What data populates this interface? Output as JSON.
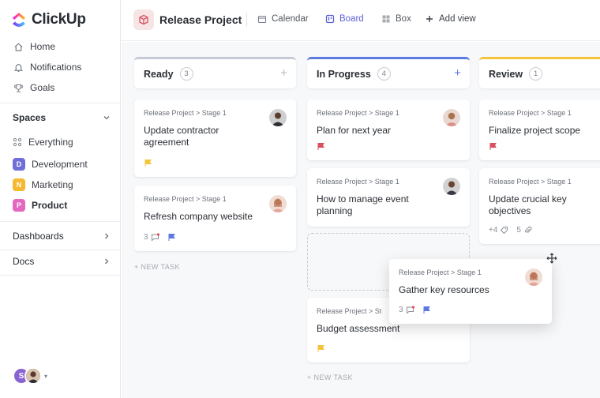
{
  "app": {
    "name": "ClickUp"
  },
  "sidebar": {
    "nav": [
      {
        "label": "Home",
        "icon": "home-icon"
      },
      {
        "label": "Notifications",
        "icon": "bell-icon"
      },
      {
        "label": "Goals",
        "icon": "trophy-icon"
      }
    ],
    "spaces_label": "Spaces",
    "spaces": [
      {
        "label": "Everything",
        "badge": ""
      },
      {
        "label": "Development",
        "badge": "D",
        "color": "#6f6fd8"
      },
      {
        "label": "Marketing",
        "badge": "N",
        "color": "#f5b82e"
      },
      {
        "label": "Product",
        "badge": "P",
        "color": "#e468c0"
      }
    ],
    "dashboards_label": "Dashboards",
    "docs_label": "Docs",
    "user_initial": "S"
  },
  "header": {
    "project_title": "Release Project",
    "views": [
      {
        "label": "Calendar"
      },
      {
        "label": "Board"
      },
      {
        "label": "Box"
      },
      {
        "label": "Add view"
      }
    ]
  },
  "board": {
    "new_task_label": "+ NEW TASK",
    "columns": [
      {
        "name": "Ready",
        "count": "3",
        "accent": "#c7c9d6",
        "cards": [
          {
            "crumb": "Release Project > Stage 1",
            "title": "Update contractor agreement",
            "flag": "#f5c43c"
          },
          {
            "crumb": "Release Project > Stage 1",
            "title": "Refresh company website",
            "comments": "3",
            "flag": "#5b7ae0"
          }
        ]
      },
      {
        "name": "In Progress",
        "count": "4",
        "accent": "#5b7ae0",
        "cards": [
          {
            "crumb": "Release Project > Stage 1",
            "title": "Plan for next year",
            "flag": "#d9505e"
          },
          {
            "crumb": "Release Project > Stage 1",
            "title": "How to manage event planning"
          },
          {
            "crumb": "Release Project > St",
            "title": "Budget assessment",
            "flag": "#f5c43c"
          }
        ]
      },
      {
        "name": "Review",
        "count": "1",
        "accent": "#f5c43c",
        "cards": [
          {
            "crumb": "Release Project > Stage 1",
            "title": "Finalize project scope",
            "flag": "#d9505e"
          },
          {
            "crumb": "Release Project > Stage 1",
            "title": "Update crucial key objectives",
            "tags": "+4",
            "attachments": "5"
          }
        ]
      }
    ],
    "dragging_card": {
      "crumb": "Release Project > Stage 1",
      "title": "Gather key resources",
      "comments": "3",
      "flag": "#5b7ae0"
    }
  }
}
